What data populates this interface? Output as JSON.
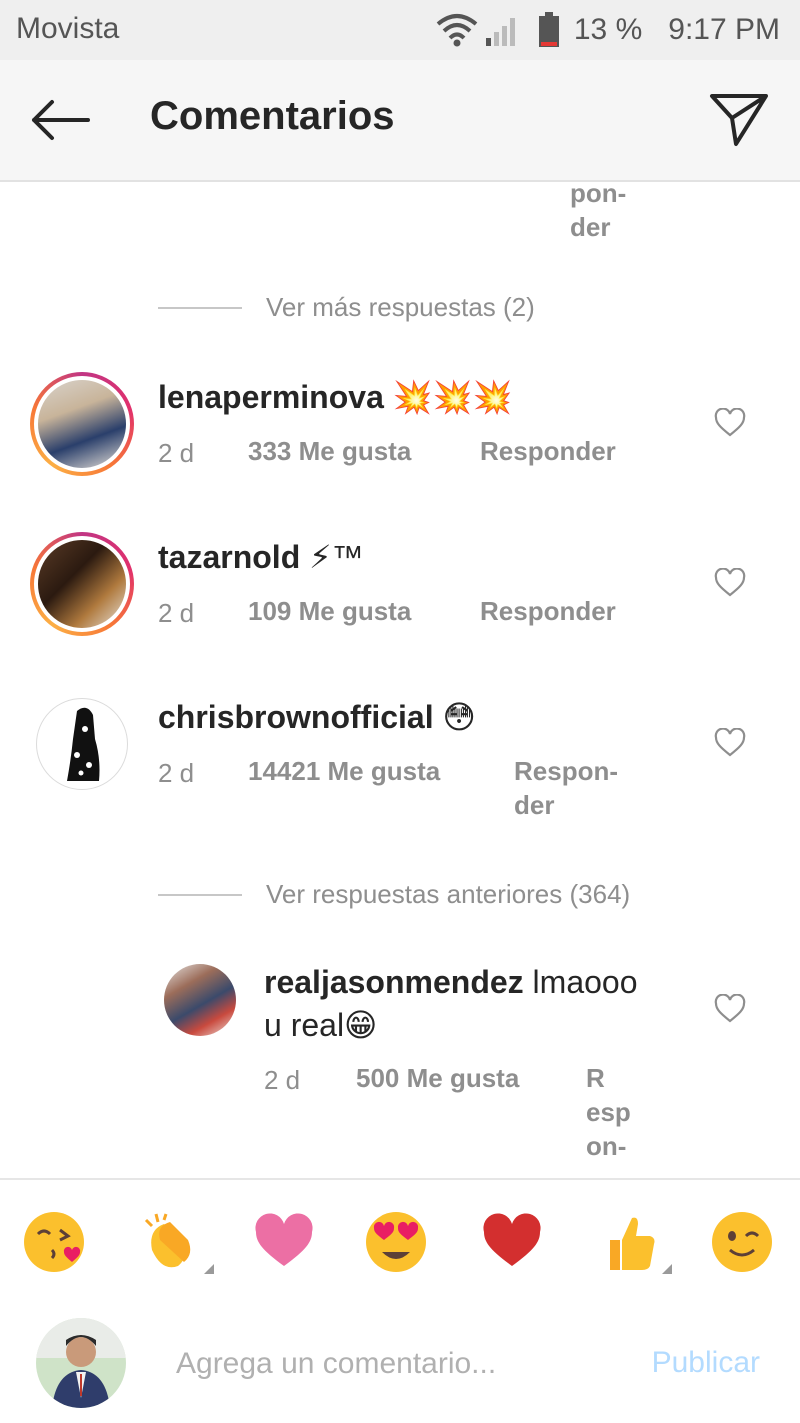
{
  "status_bar": {
    "carrier": "Movista",
    "battery": "13 %",
    "time": "9:17 PM",
    "icons": [
      "wifi-icon",
      "signal-icon",
      "battery-icon"
    ]
  },
  "header": {
    "title": "Comentarios",
    "icons": [
      "back-arrow-icon",
      "send-icon"
    ]
  },
  "top_partial_reply": "pon-\nder",
  "more_replies_1": "Ver más respuestas (2)",
  "comments": [
    {
      "username": "lenaperminova",
      "text": "💥💥💥",
      "age": "2 d",
      "likes": "333 Me gusta",
      "reply": "Responder"
    },
    {
      "username": "tazarnold",
      "text": "⚡™",
      "age": "2 d",
      "likes": "109 Me gusta",
      "reply": "Responder"
    },
    {
      "username": "chrisbrownofficial",
      "text": "😳",
      "age": "2 d",
      "likes": "14421 Me gusta",
      "reply": "Respon-\nder"
    }
  ],
  "more_replies_2": "Ver respuestas anteriores (364)",
  "reply": {
    "username": "realjasonmendez",
    "text_line1": "lmaooo",
    "text_line2": "u real😁",
    "age": "2 d",
    "likes": "500 Me gusta",
    "reply": "R\nesp\non-"
  },
  "emoji_bar": [
    "😘",
    "👏",
    "💗",
    "😍",
    "❤️",
    "👍",
    "😉"
  ],
  "input": {
    "placeholder": "Agrega un comentario...",
    "value": "",
    "publish_label": "Publicar"
  },
  "colors": {
    "secondary_text": "#8e8e8e",
    "publish_disabled": "#b3dbff",
    "story_ring_start": "#c13584",
    "story_ring_end": "#fcaf45"
  }
}
